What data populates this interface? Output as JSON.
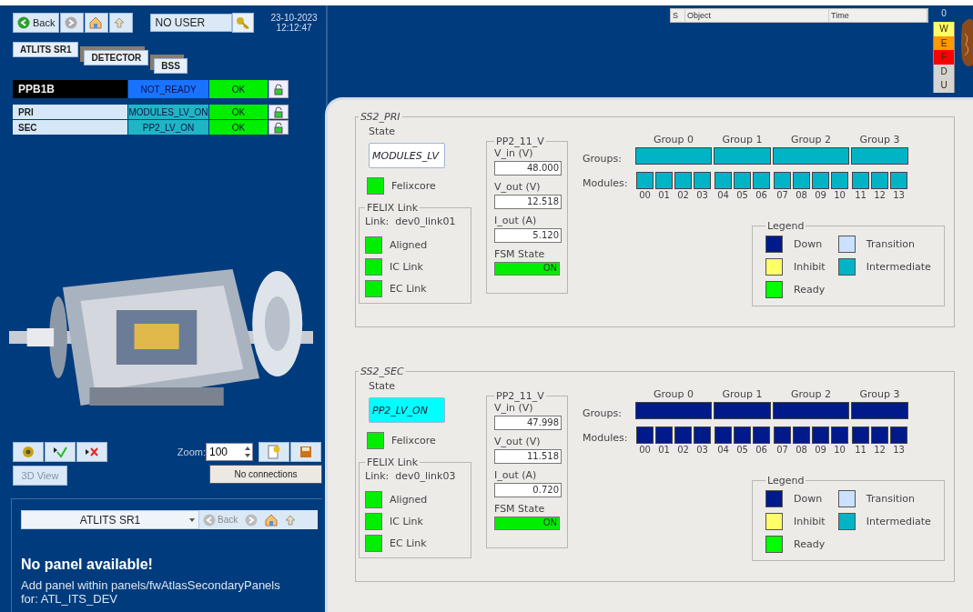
{
  "toolbar": {
    "back": "Back",
    "user": "NO USER",
    "date": "23-10-2023",
    "time": "12:12:47"
  },
  "breadcrumbs": [
    "ATLITS SR1",
    "DETECTOR",
    "BSS"
  ],
  "node": {
    "name": "PPB1B",
    "state": "NOT_READY",
    "color": "#1a73ff",
    "status": "OK"
  },
  "children": [
    {
      "name": "PRI",
      "state": "MODULES_LV_ON",
      "color": "#1fb5c4",
      "status": "OK"
    },
    {
      "name": "SEC",
      "state": "PP2_LV_ON",
      "color": "#1fb5c4",
      "status": "OK"
    }
  ],
  "alarm_table": {
    "columns": [
      "S",
      "Object",
      "Time"
    ]
  },
  "alarm_summary": {
    "count": "0",
    "levels": [
      {
        "label": "W",
        "color": "#ffff66"
      },
      {
        "label": "E",
        "color": "#ff9900"
      },
      {
        "label": "F",
        "color": "#ff0000"
      },
      {
        "label": "D",
        "color": "#d4d4d4"
      },
      {
        "label": "U",
        "color": "#d4d4d4"
      }
    ]
  },
  "view_controls": {
    "zoom_label": "Zoom:",
    "zoom": "100",
    "view_button": "3D View",
    "view_disabled": true,
    "connections": "No connections"
  },
  "secondary": {
    "selector": "ATLITS SR1",
    "back": "Back",
    "title": "No panel available!",
    "message": "Add panel within panels/fwAtlasSecondaryPanels",
    "message_2": "for: ATL_ITS_DEV"
  },
  "panels": [
    {
      "title": "SS2_PRI",
      "state_label": "State",
      "state": "MODULES_LV",
      "highlighted": false,
      "felixcore": {
        "label": "Felixcore",
        "ok": true
      },
      "felix_link": {
        "title": "FELIX Link",
        "link": "Link:  dev0_link01",
        "items": [
          {
            "label": "Aligned",
            "ok": true
          },
          {
            "label": "IC Link",
            "ok": true
          },
          {
            "label": "EC Link",
            "ok": true
          }
        ]
      },
      "power": {
        "title": "PP2_11_V",
        "fields": [
          {
            "label": "V_in (V)",
            "value": "48.000"
          },
          {
            "label": "V_out (V)",
            "value": "12.518"
          },
          {
            "label": "I_out (A)",
            "value": "5.120"
          }
        ],
        "fsm_label": "FSM State",
        "fsm_value": "ON",
        "fsm_on": true
      },
      "groups_label": "Groups:",
      "modules_label": "Modules:",
      "groups": [
        {
          "label": "Group 0",
          "color": "#00b4c6",
          "modules": [
            {
              "label": "00",
              "color": "#00b4c6"
            },
            {
              "label": "01",
              "color": "#00b4c6"
            },
            {
              "label": "02",
              "color": "#00b4c6"
            },
            {
              "label": "03",
              "color": "#00b4c6"
            }
          ]
        },
        {
          "label": "Group 1",
          "color": "#00b4c6",
          "modules": [
            {
              "label": "04",
              "color": "#00b4c6"
            },
            {
              "label": "05",
              "color": "#00b4c6"
            },
            {
              "label": "06",
              "color": "#00b4c6"
            }
          ]
        },
        {
          "label": "Group 2",
          "color": "#00b4c6",
          "modules": [
            {
              "label": "07",
              "color": "#00b4c6"
            },
            {
              "label": "08",
              "color": "#00b4c6"
            },
            {
              "label": "09",
              "color": "#00b4c6"
            },
            {
              "label": "10",
              "color": "#00b4c6"
            }
          ]
        },
        {
          "label": "Group 3",
          "color": "#00b4c6",
          "modules": [
            {
              "label": "11",
              "color": "#00b4c6"
            },
            {
              "label": "12",
              "color": "#00b4c6"
            },
            {
              "label": "13",
              "color": "#00b4c6"
            }
          ]
        }
      ],
      "legend": {
        "title": "Legend",
        "items": [
          {
            "label": "Down",
            "color": "#001a8c"
          },
          {
            "label": "Transition",
            "color": "#cce0ff"
          },
          {
            "label": "Inhibit",
            "color": "#ffff66"
          },
          {
            "label": "Intermediate",
            "color": "#00b4c6"
          },
          {
            "label": "Ready",
            "color": "#00ff00"
          }
        ]
      }
    },
    {
      "title": "SS2_SEC",
      "state_label": "State",
      "state": "PP2_LV_ON",
      "highlighted": true,
      "felixcore": {
        "label": "Felixcore",
        "ok": true
      },
      "felix_link": {
        "title": "FELIX Link",
        "link": "Link:  dev0_link03",
        "items": [
          {
            "label": "Aligned",
            "ok": true
          },
          {
            "label": "IC Link",
            "ok": true
          },
          {
            "label": "EC Link",
            "ok": true
          }
        ]
      },
      "power": {
        "title": "PP2_11_V",
        "fields": [
          {
            "label": "V_in (V)",
            "value": "47.998"
          },
          {
            "label": "V_out (V)",
            "value": "11.518"
          },
          {
            "label": "I_out (A)",
            "value": "0.720"
          }
        ],
        "fsm_label": "FSM State",
        "fsm_value": "ON",
        "fsm_on": true
      },
      "groups_label": "Groups:",
      "modules_label": "Modules:",
      "groups": [
        {
          "label": "Group 0",
          "color": "#001a8c",
          "modules": [
            {
              "label": "00",
              "color": "#001a8c"
            },
            {
              "label": "01",
              "color": "#001a8c"
            },
            {
              "label": "02",
              "color": "#001a8c"
            },
            {
              "label": "03",
              "color": "#001a8c"
            }
          ]
        },
        {
          "label": "Group 1",
          "color": "#001a8c",
          "modules": [
            {
              "label": "04",
              "color": "#001a8c"
            },
            {
              "label": "05",
              "color": "#001a8c"
            },
            {
              "label": "06",
              "color": "#001a8c"
            }
          ]
        },
        {
          "label": "Group 2",
          "color": "#001a8c",
          "modules": [
            {
              "label": "07",
              "color": "#001a8c"
            },
            {
              "label": "08",
              "color": "#001a8c"
            },
            {
              "label": "09",
              "color": "#001a8c"
            },
            {
              "label": "10",
              "color": "#001a8c"
            }
          ]
        },
        {
          "label": "Group 3",
          "color": "#001a8c",
          "modules": [
            {
              "label": "11",
              "color": "#001a8c"
            },
            {
              "label": "12",
              "color": "#001a8c"
            },
            {
              "label": "13",
              "color": "#001a8c"
            }
          ]
        }
      ],
      "legend": {
        "title": "Legend",
        "items": [
          {
            "label": "Down",
            "color": "#001a8c"
          },
          {
            "label": "Transition",
            "color": "#cce0ff"
          },
          {
            "label": "Inhibit",
            "color": "#ffff66"
          },
          {
            "label": "Intermediate",
            "color": "#00b4c6"
          },
          {
            "label": "Ready",
            "color": "#00ff00"
          }
        ]
      }
    }
  ]
}
